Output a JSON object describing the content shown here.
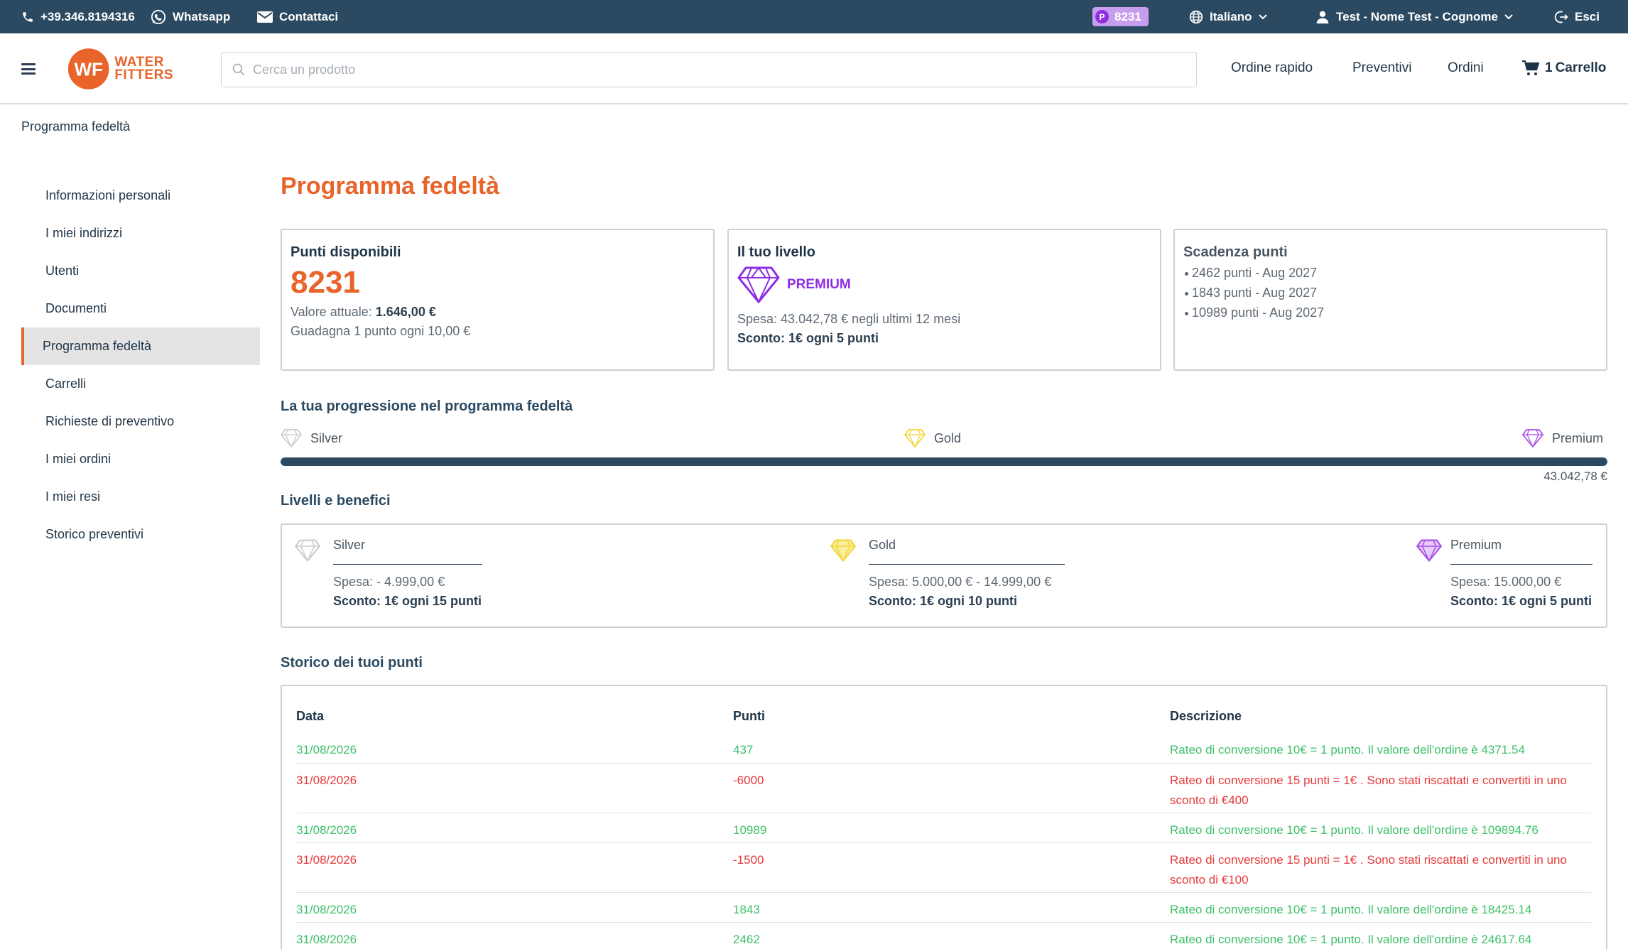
{
  "topbar": {
    "phone": "+39.346.8194316",
    "whatsapp": "Whatsapp",
    "contact": "Contattaci",
    "points_badge": "8231",
    "points_badge_letter": "P",
    "language": "Italiano",
    "user": "Test - Nome Test - Cognome",
    "logout": "Esci"
  },
  "header": {
    "logo_line1": "WATER",
    "logo_line2": "FITTERS",
    "logo_mark": "WF",
    "search_placeholder": "Cerca un prodotto",
    "nav": {
      "quick_order": "Ordine rapido",
      "quotes": "Preventivi",
      "orders": "Ordini",
      "cart_count": "1",
      "cart_label": "Carrello"
    }
  },
  "breadcrumb": "Programma fedeltà",
  "sidebar": {
    "items": [
      {
        "label": "Informazioni personali",
        "active": false
      },
      {
        "label": "I miei indirizzi",
        "active": false
      },
      {
        "label": "Utenti",
        "active": false
      },
      {
        "label": "Documenti",
        "active": false
      },
      {
        "label": "Programma fedeltà",
        "active": true
      },
      {
        "label": "Carrelli",
        "active": false
      },
      {
        "label": "Richieste di preventivo",
        "active": false
      },
      {
        "label": "I miei ordini",
        "active": false
      },
      {
        "label": "I miei resi",
        "active": false
      },
      {
        "label": "Storico preventivi",
        "active": false
      }
    ]
  },
  "main": {
    "title": "Programma fedeltà",
    "available": {
      "title": "Punti disponibili",
      "points": "8231",
      "value_label": "Valore attuale:",
      "value": "1.646,00 €",
      "earn": "Guadagna 1 punto ogni 10,00 €"
    },
    "level": {
      "title": "Il tuo livello",
      "name": "PREMIUM",
      "spend": "Spesa: 43.042,78 € negli ultimi 12 mesi",
      "discount": "Sconto: 1€ ogni 5 punti"
    },
    "expiry": {
      "title": "Scadenza punti",
      "items": [
        "2462 punti - Aug 2027",
        "1843 punti - Aug 2027",
        "10989 punti - Aug 2027"
      ]
    },
    "progress": {
      "title": "La tua progressione nel programma fedeltà",
      "labels": [
        "Silver",
        "Gold",
        "Premium"
      ],
      "fraction": 1.0,
      "value": "43.042,78 €"
    },
    "levels": {
      "title": "Livelli e benefici",
      "items": [
        {
          "name": "Silver",
          "spend": "Spesa: - 4.999,00 €",
          "discount": "Sconto: 1€ ogni 15 punti"
        },
        {
          "name": "Gold",
          "spend": "Spesa: 5.000,00 € - 14.999,00 €",
          "discount": "Sconto: 1€ ogni 10 punti"
        },
        {
          "name": "Premium",
          "spend": "Spesa: 15.000,00 €",
          "discount": "Sconto: 1€ ogni 5 punti"
        }
      ]
    },
    "history": {
      "title": "Storico dei tuoi punti",
      "columns": [
        "Data",
        "Punti",
        "Descrizione"
      ],
      "rows": [
        {
          "date": "31/08/2026",
          "points": "437",
          "desc": "Rateo di conversione 10€ = 1 punto. Il valore dell'ordine è 4371.54"
        },
        {
          "date": "31/08/2026",
          "points": "-6000",
          "desc": "Rateo di conversione 15 punti = 1€ . Sono stati riscattati e convertiti in uno sconto di €400"
        },
        {
          "date": "31/08/2026",
          "points": "10989",
          "desc": "Rateo di conversione 10€ = 1 punto. Il valore dell'ordine è 109894.76"
        },
        {
          "date": "31/08/2026",
          "points": "-1500",
          "desc": "Rateo di conversione 15 punti = 1€ . Sono stati riscattati e convertiti in uno sconto di €100"
        },
        {
          "date": "31/08/2026",
          "points": "1843",
          "desc": "Rateo di conversione 10€ = 1 punto. Il valore dell'ordine è 18425.14"
        },
        {
          "date": "31/08/2026",
          "points": "2462",
          "desc": "Rateo di conversione 10€ = 1 punto. Il valore dell'ordine è 24617.64"
        }
      ]
    }
  },
  "colors": {
    "topbar": "#2b4a62",
    "accent": "#e8642a",
    "premium": "#8e2de2",
    "gold": "#f2d43a",
    "silver": "#c7ccd1",
    "gain": "#3ec06a",
    "spend": "#e63a3a"
  }
}
